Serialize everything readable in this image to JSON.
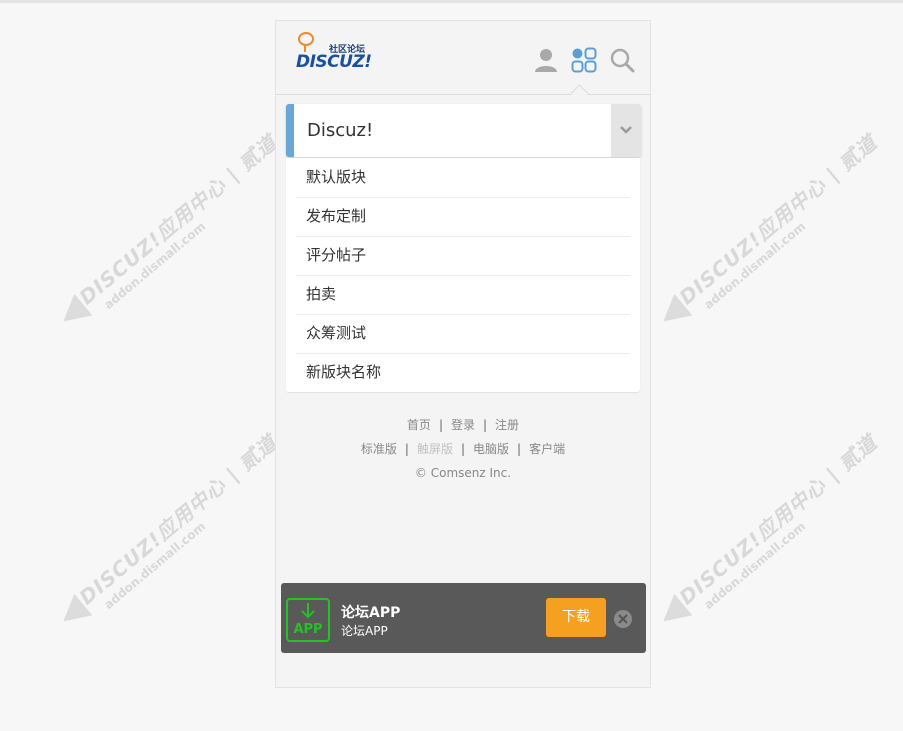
{
  "header": {
    "logo_tag": "社区论坛",
    "logo_word": "DISCUZ!"
  },
  "selector": {
    "current": "Discuz!"
  },
  "menu": {
    "items": [
      "默认版块",
      "发布定制",
      "评分帖子",
      "拍卖",
      "众筹测试",
      "新版块名称"
    ]
  },
  "footer": {
    "links": [
      "首页",
      "登录",
      "注册"
    ],
    "versions": [
      "标准版",
      "触屏版",
      "电脑版",
      "客户端"
    ],
    "copyright": "© Comsenz Inc."
  },
  "appbar": {
    "icon_text": "APP",
    "title": "论坛APP",
    "subtitle": "论坛APP",
    "download": "下载"
  },
  "watermark": {
    "brand": "DISCUZ!应用中心 | 贰道",
    "sub": "addon.dismall.com"
  },
  "colors": {
    "accent": "#6aa6d6",
    "download": "#f5a020",
    "app_green": "#22c322"
  }
}
